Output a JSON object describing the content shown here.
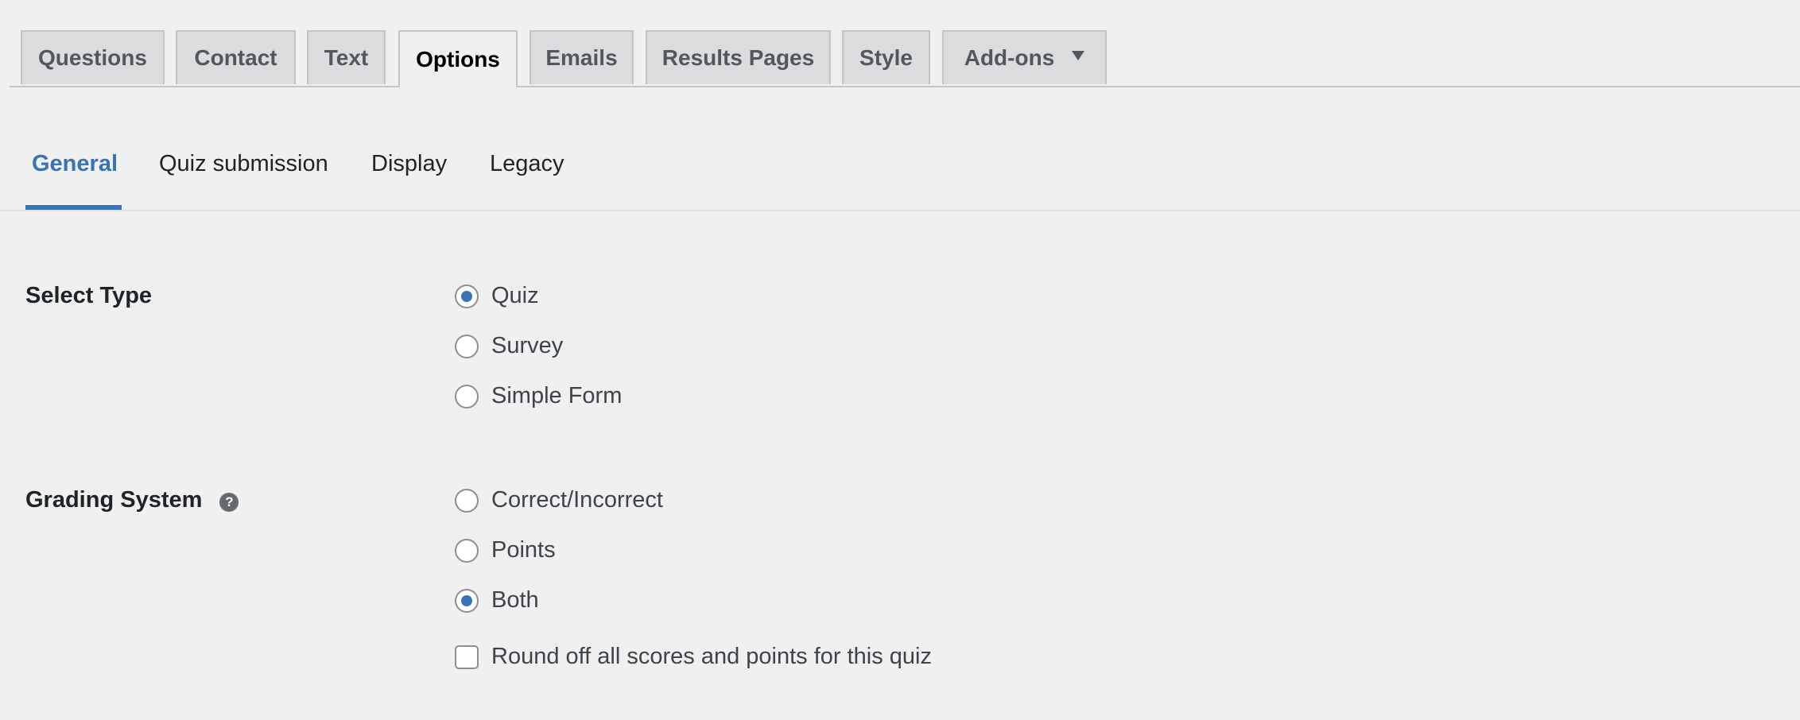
{
  "nav_tabs": [
    {
      "label": "Questions",
      "active": false
    },
    {
      "label": "Contact",
      "active": false
    },
    {
      "label": "Text",
      "active": false
    },
    {
      "label": "Options",
      "active": true
    },
    {
      "label": "Emails",
      "active": false
    },
    {
      "label": "Results Pages",
      "active": false
    },
    {
      "label": "Style",
      "active": false
    },
    {
      "label": "Add-ons",
      "active": false,
      "has_dropdown": true
    }
  ],
  "sub_tabs": [
    {
      "label": "General",
      "active": true
    },
    {
      "label": "Quiz submission",
      "active": false
    },
    {
      "label": "Display",
      "active": false
    },
    {
      "label": "Legacy",
      "active": false
    }
  ],
  "settings": {
    "select_type": {
      "label": "Select Type",
      "options": [
        {
          "label": "Quiz",
          "checked": true
        },
        {
          "label": "Survey",
          "checked": false
        },
        {
          "label": "Simple Form",
          "checked": false
        }
      ]
    },
    "grading_system": {
      "label": "Grading System",
      "help_icon": "?",
      "options": [
        {
          "label": "Correct/Incorrect",
          "checked": false
        },
        {
          "label": "Points",
          "checked": false
        },
        {
          "label": "Both",
          "checked": true
        }
      ],
      "round_off": {
        "label": "Round off all scores and points for this quiz",
        "checked": false
      }
    }
  },
  "colors": {
    "accent": "#3873b3",
    "background": "#f0f0f1",
    "tab_inactive": "#dcdcde"
  }
}
